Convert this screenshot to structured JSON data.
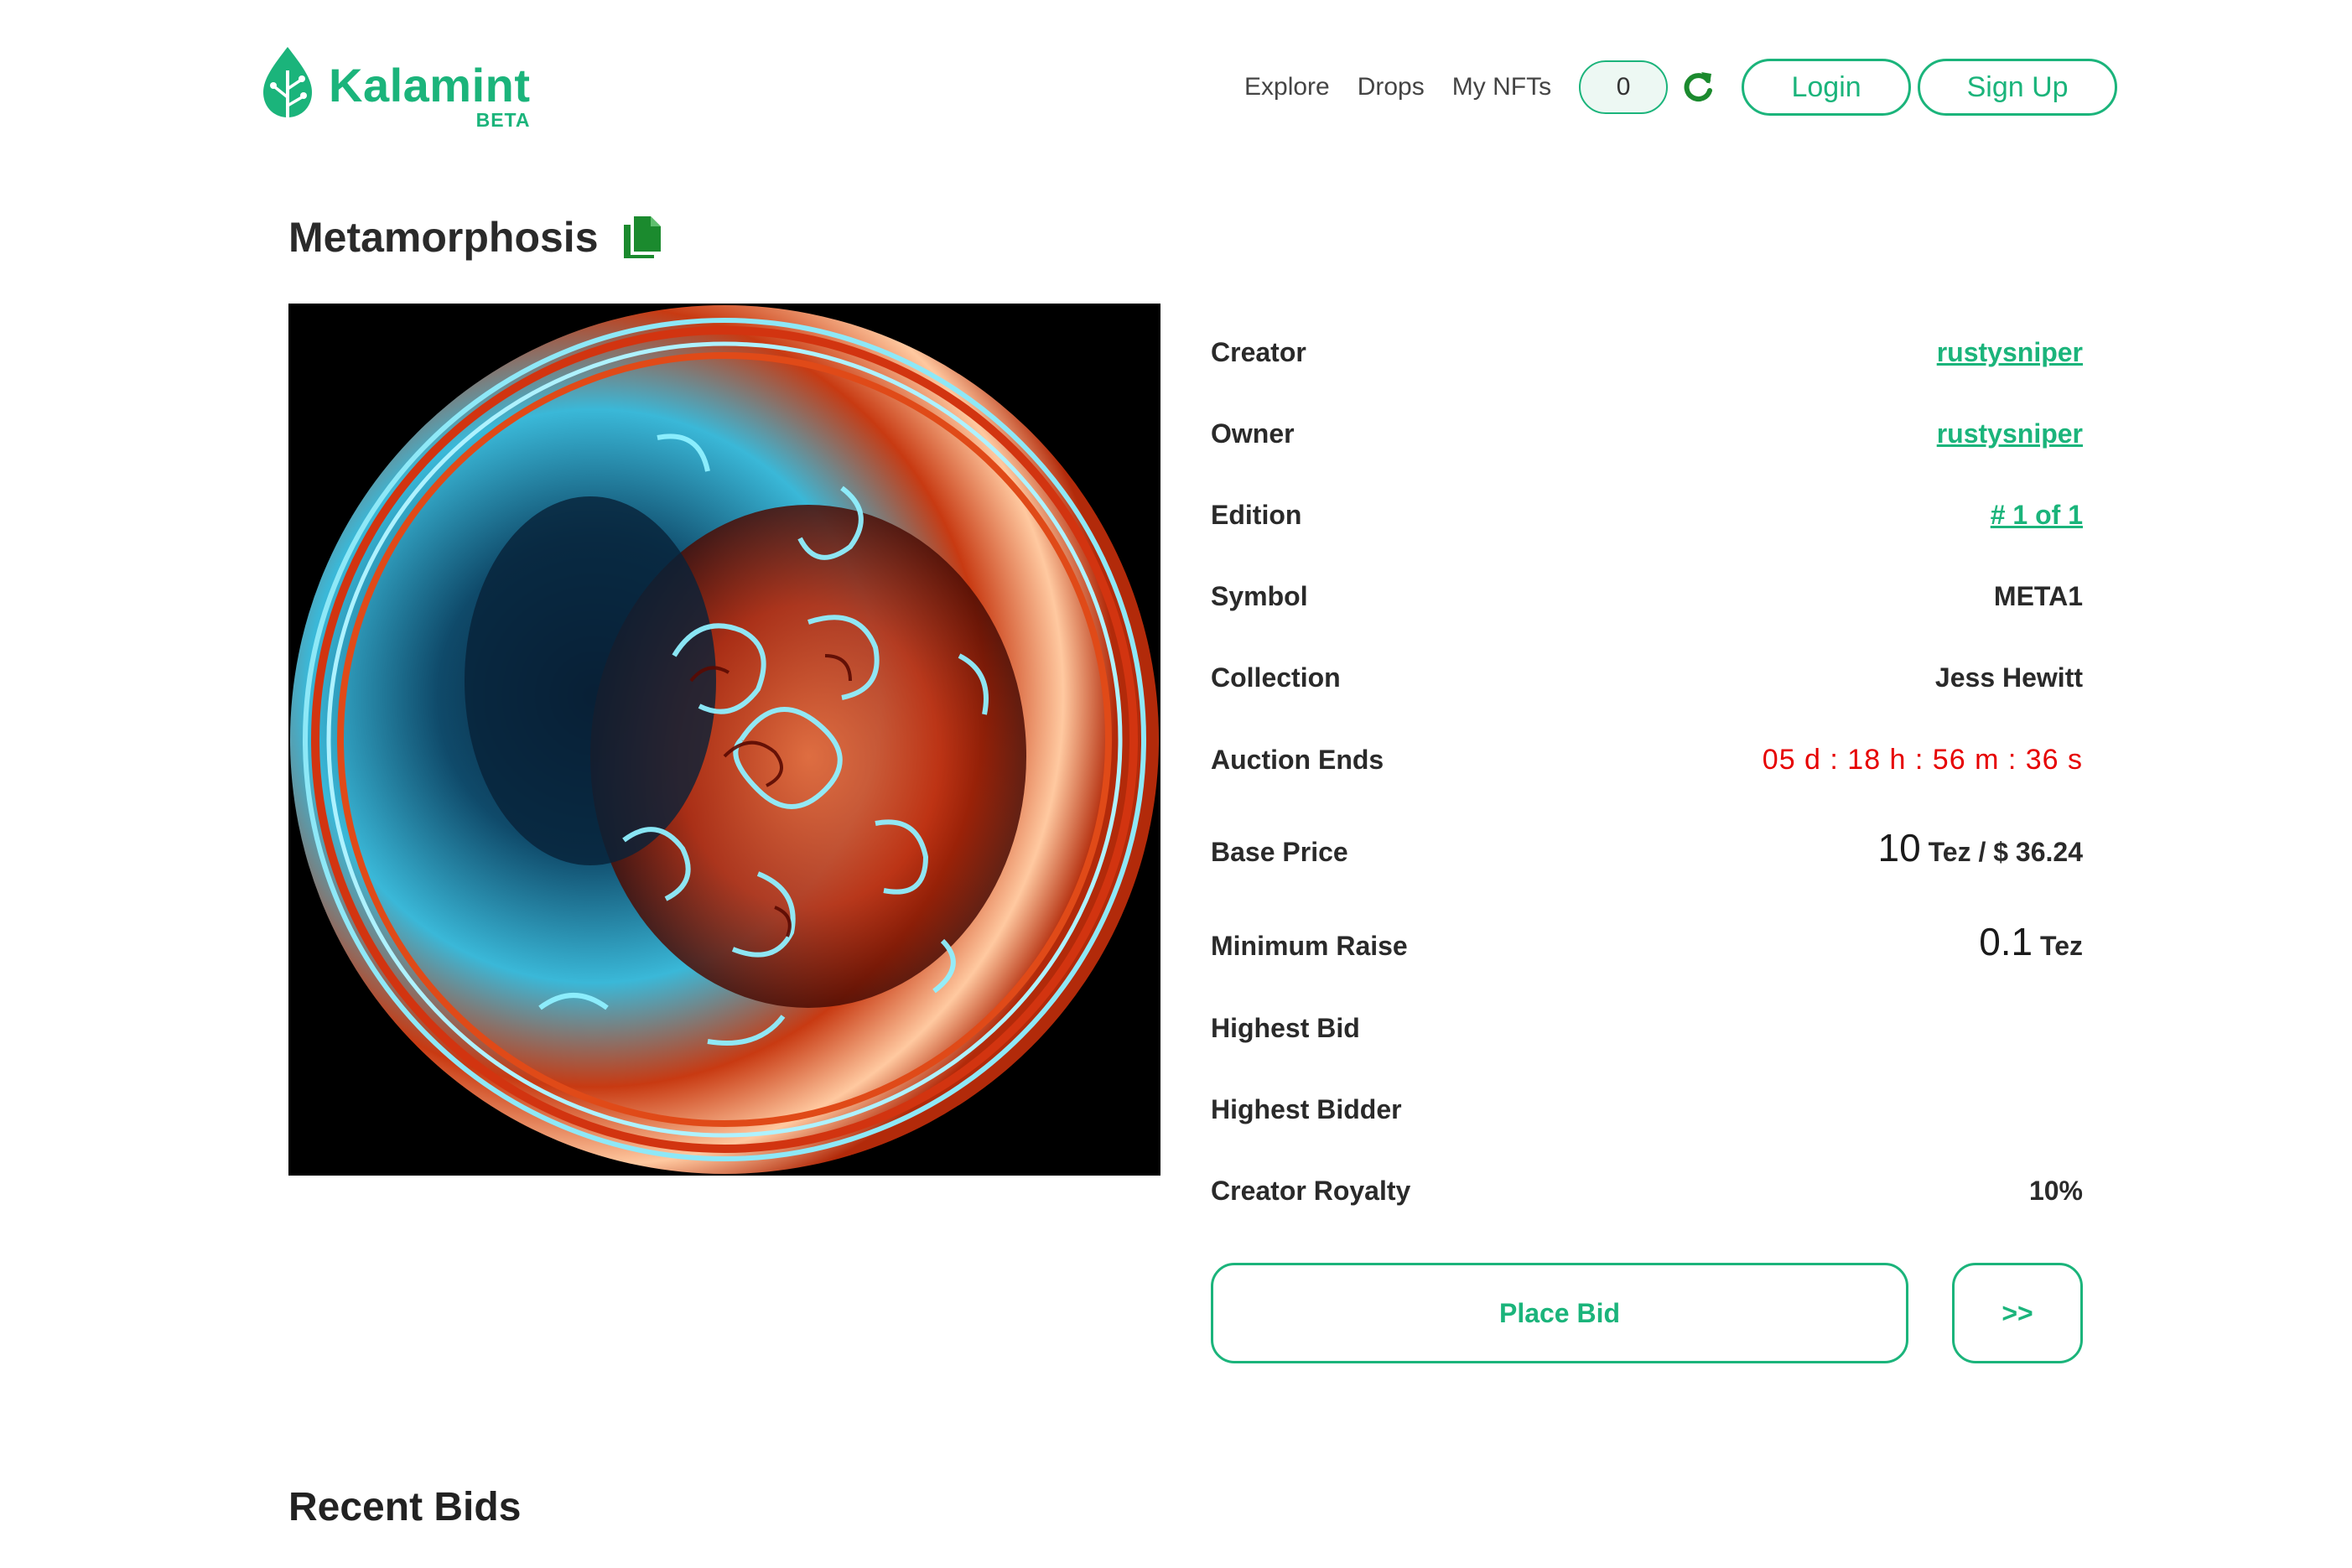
{
  "brand": {
    "name": "Kalamint",
    "badge": "BETA",
    "color": "#1bb47b"
  },
  "nav": {
    "links": [
      "Explore",
      "Drops",
      "My NFTs"
    ],
    "wallet_count": "0",
    "login_label": "Login",
    "signup_label": "Sign Up"
  },
  "nft": {
    "title": "Metamorphosis",
    "details": {
      "creator_label": "Creator",
      "creator": "rustysniper",
      "owner_label": "Owner",
      "owner": "rustysniper",
      "edition_label": "Edition",
      "edition": "# 1 of 1",
      "symbol_label": "Symbol",
      "symbol": "META1",
      "collection_label": "Collection",
      "collection": "Jess Hewitt",
      "auction_label": "Auction Ends",
      "auction_ends": "05 d : 18 h : 56 m : 36 s",
      "base_price_label": "Base Price",
      "base_price_amount": "10",
      "base_price_unit": "Tez / $ 36.24",
      "min_raise_label": "Minimum Raise",
      "min_raise_amount": "0.1",
      "min_raise_unit": "Tez",
      "highest_bid_label": "Highest Bid",
      "highest_bid": "",
      "highest_bidder_label": "Highest Bidder",
      "highest_bidder": "",
      "royalty_label": "Creator Royalty",
      "royalty": "10%"
    },
    "place_bid_label": "Place Bid",
    "next_label": ">>"
  },
  "recent_bids": {
    "heading": "Recent Bids"
  },
  "colors": {
    "accent": "#1bb47b",
    "timer": "#e60000"
  }
}
